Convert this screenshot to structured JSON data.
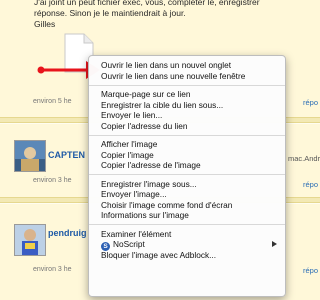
{
  "post": {
    "lines": [
      "J'ai joint un peut fichier exec, vous, completer le, enregistrer",
      "réponse. Sinon je le maintiendrait à jour.",
      "Gilles"
    ],
    "meta": "environ 5 he",
    "reply": "répo"
  },
  "rows": [
    {
      "username": "CAPTEN",
      "meta": "environ 3 he",
      "snippet": "mac.Andr",
      "reply": "répo"
    },
    {
      "username": "pendruig",
      "meta": "environ 3 he",
      "reply": "répo"
    }
  ],
  "context_menu": {
    "groups": [
      [
        "Ouvrir le lien dans un nouvel onglet",
        "Ouvrir le lien dans une nouvelle fenêtre"
      ],
      [
        "Marque-page sur ce lien",
        "Enregistrer la cible du lien sous...",
        "Envoyer le lien...",
        "Copier l'adresse du lien"
      ],
      [
        "Afficher l'image",
        "Copier l'image",
        "Copier l'adresse de l'image"
      ],
      [
        "Enregistrer l'image sous...",
        "Envoyer l'image...",
        "Choisir l'image comme fond d'écran",
        "Informations sur l'image"
      ],
      [
        "Examiner l'élément",
        "NoScript",
        "Bloquer l'image avec Adblock..."
      ]
    ],
    "noscript_badge": "S"
  },
  "colors": {
    "annotation_arrow": "#e8141c",
    "link_blue": "#1f5aa6"
  },
  "icons": [
    "file-icon",
    "noscript-icon",
    "submenu-arrow-icon"
  ]
}
